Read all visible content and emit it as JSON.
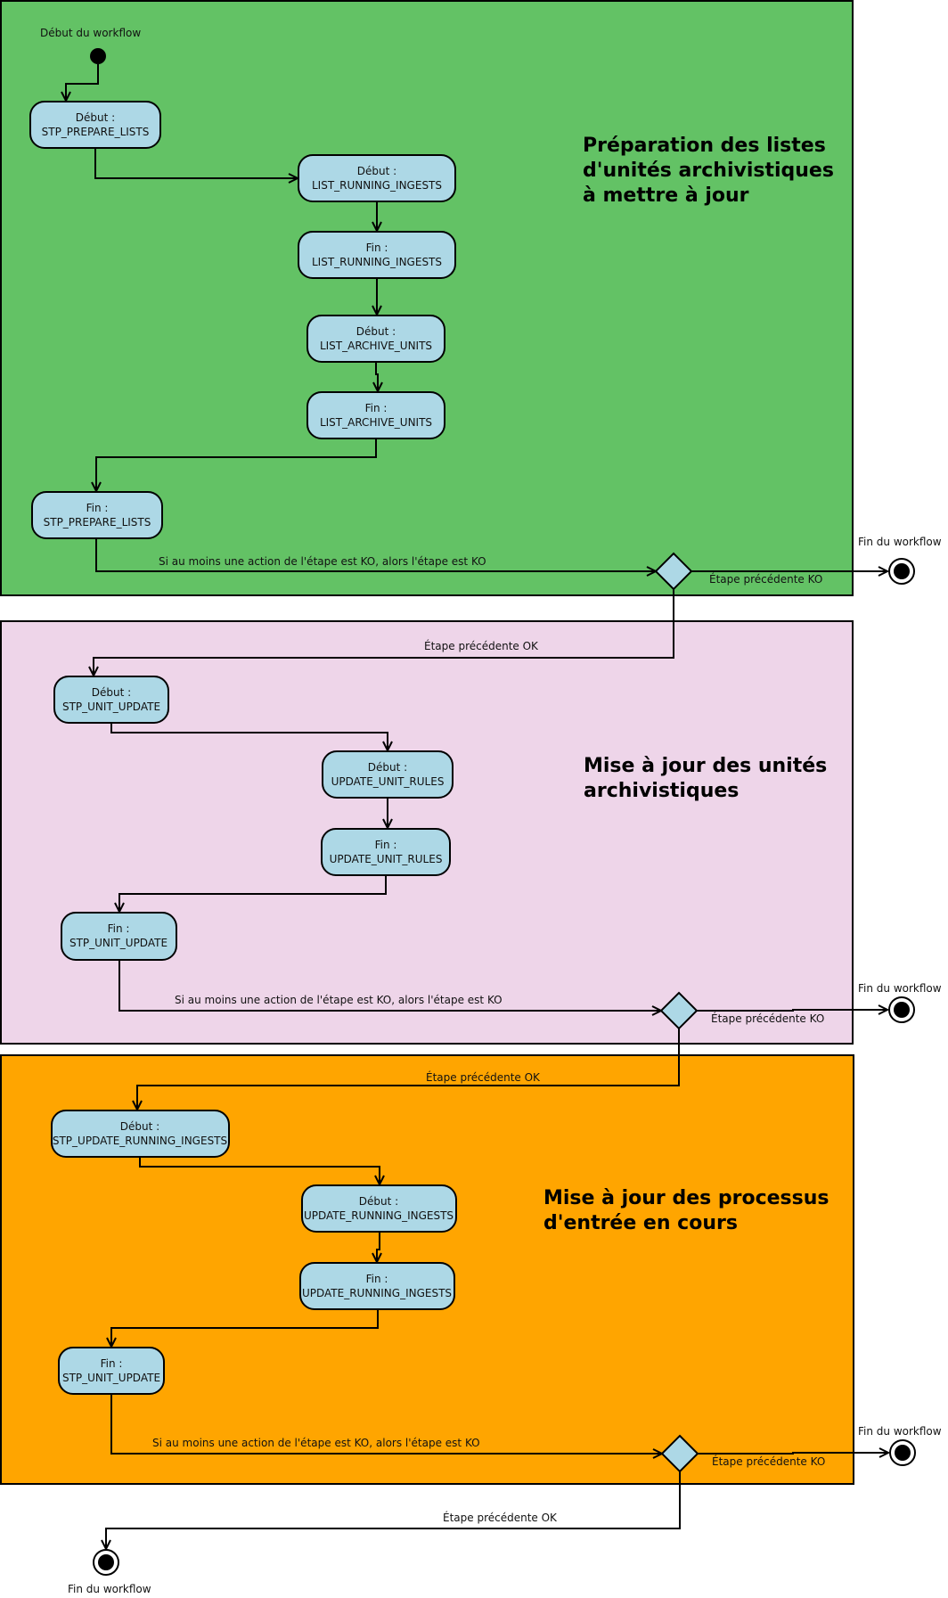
{
  "diagram": {
    "type": "uml-activity-workflow",
    "start_label": "Début du workflow",
    "end_label": "Fin du workflow",
    "colors": {
      "node_fill": "#ADD8E6",
      "decision_fill": "#ADD8E6",
      "stroke": "#000000"
    },
    "sections": [
      {
        "id": "prepare",
        "title_lines": [
          "Préparation des listes",
          "d'unités archivistiques",
          "à mettre à jour"
        ],
        "color": "#63C265",
        "nodes": [
          {
            "id": "s1n1",
            "prefix": "Début :",
            "name": "STP_PREPARE_LISTS"
          },
          {
            "id": "s1n2",
            "prefix": "Début :",
            "name": "LIST_RUNNING_INGESTS"
          },
          {
            "id": "s1n3",
            "prefix": "Fin :",
            "name": "LIST_RUNNING_INGESTS"
          },
          {
            "id": "s1n4",
            "prefix": "Début :",
            "name": "LIST_ARCHIVE_UNITS"
          },
          {
            "id": "s1n5",
            "prefix": "Fin :",
            "name": "LIST_ARCHIVE_UNITS"
          },
          {
            "id": "s1n6",
            "prefix": "Fin :",
            "name": "STP_PREPARE_LISTS"
          }
        ],
        "ko_condition": "Si au moins une action de l'étape est KO, alors l'étape est KO",
        "ko_branch": "Étape précédente KO",
        "ok_branch": "Étape précédente OK"
      },
      {
        "id": "unit-update",
        "title_lines": [
          "Mise à jour des unités",
          "archivistiques"
        ],
        "color": "#EED5E9",
        "nodes": [
          {
            "id": "s2n1",
            "prefix": "Début :",
            "name": "STP_UNIT_UPDATE"
          },
          {
            "id": "s2n2",
            "prefix": "Début :",
            "name": "UPDATE_UNIT_RULES"
          },
          {
            "id": "s2n3",
            "prefix": "Fin :",
            "name": "UPDATE_UNIT_RULES"
          },
          {
            "id": "s2n4",
            "prefix": "Fin :",
            "name": "STP_UNIT_UPDATE"
          }
        ],
        "ko_condition": "Si au moins une action de l'étape est KO, alors l'étape est KO",
        "ko_branch": "Étape précédente KO",
        "ok_branch": "Étape précédente OK"
      },
      {
        "id": "running-ingests",
        "title_lines": [
          "Mise à jour des processus",
          "d'entrée en cours"
        ],
        "color": "#FFA500",
        "nodes": [
          {
            "id": "s3n1",
            "prefix": "Début :",
            "name": "STP_UPDATE_RUNNING_INGESTS"
          },
          {
            "id": "s3n2",
            "prefix": "Début :",
            "name": "UPDATE_RUNNING_INGESTS"
          },
          {
            "id": "s3n3",
            "prefix": "Fin :",
            "name": "UPDATE_RUNNING_INGESTS"
          },
          {
            "id": "s3n4",
            "prefix": "Fin :",
            "name": "STP_UNIT_UPDATE"
          }
        ],
        "ko_condition": "Si au moins une action de l'étape est KO, alors l'étape est KO",
        "ko_branch": "Étape précédente KO",
        "ok_branch": "Étape précédente OK"
      }
    ]
  }
}
